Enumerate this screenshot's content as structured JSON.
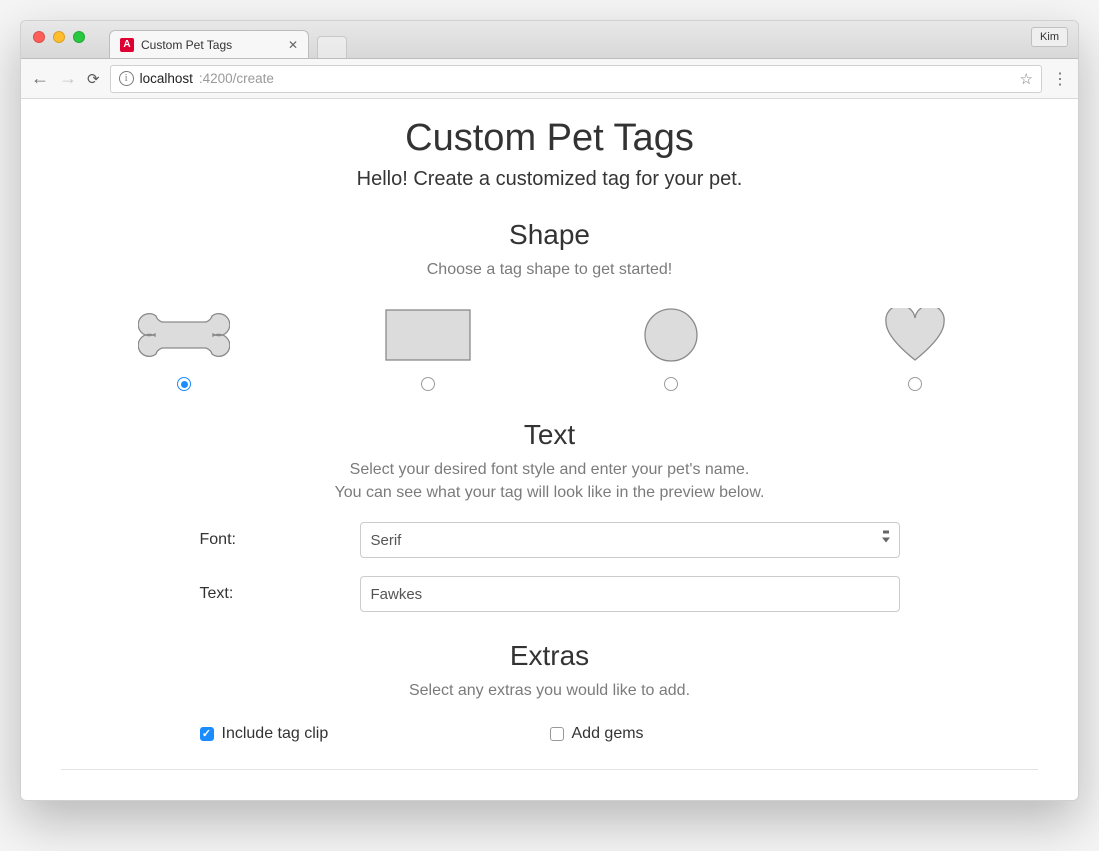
{
  "browser": {
    "tab_title": "Custom Pet Tags",
    "profile": "Kim",
    "url_host": "localhost",
    "url_path": ":4200/create"
  },
  "page": {
    "title": "Custom Pet Tags",
    "subtitle": "Hello! Create a customized tag for your pet."
  },
  "shape": {
    "heading": "Shape",
    "desc": "Choose a tag shape to get started!",
    "options": [
      "bone",
      "rectangle",
      "circle",
      "heart"
    ],
    "selected_index": 0
  },
  "text": {
    "heading": "Text",
    "desc_line1": "Select your desired font style and enter your pet's name.",
    "desc_line2": "You can see what your tag will look like in the preview below.",
    "font_label": "Font:",
    "font_value": "Serif",
    "text_label": "Text:",
    "text_value": "Fawkes"
  },
  "extras": {
    "heading": "Extras",
    "desc": "Select any extras you would like to add.",
    "clip_label": "Include tag clip",
    "clip_checked": true,
    "gems_label": "Add gems",
    "gems_checked": false
  }
}
